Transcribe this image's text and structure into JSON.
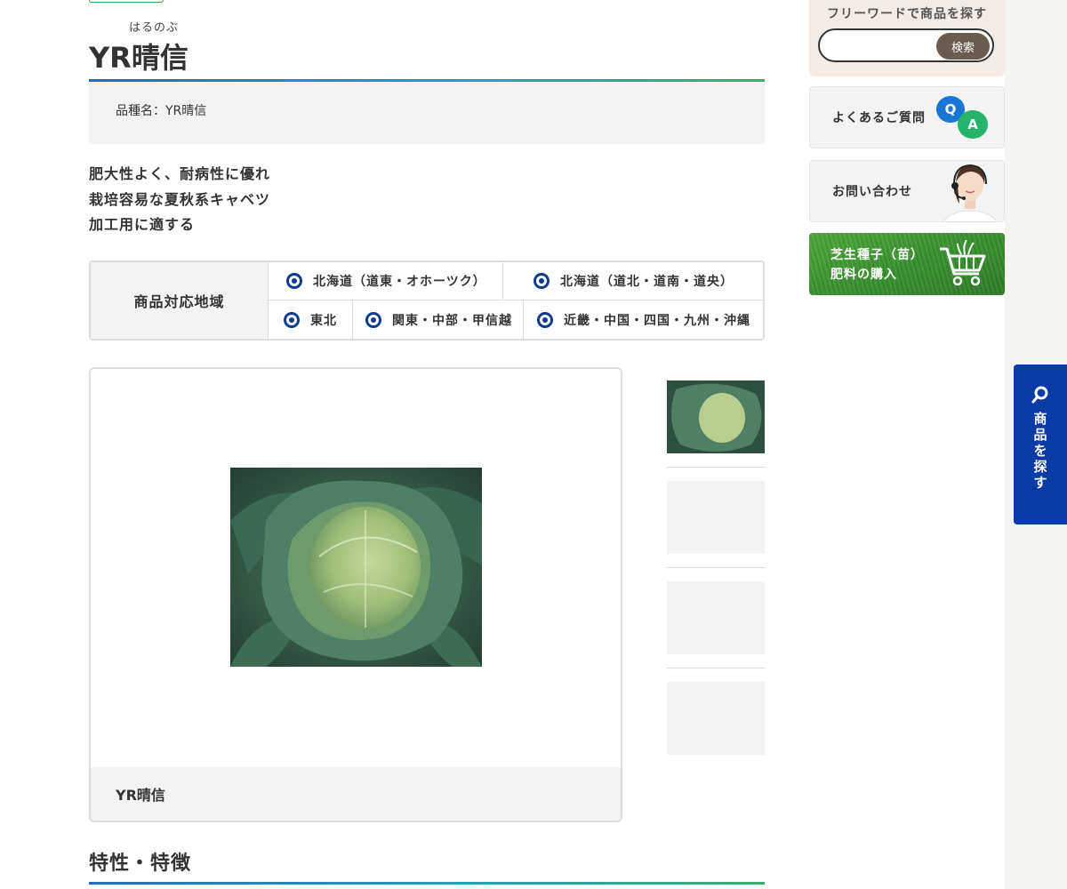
{
  "product": {
    "ruby": "はるのぶ",
    "title": "YR晴信",
    "variety_label": "品種名：YR晴信",
    "description": [
      "肥大性よく、耐病性に優れ",
      "栽培容易な夏秋系キャベツ",
      "加工用に適する"
    ]
  },
  "regions": {
    "heading": "商品対応地域",
    "items": [
      {
        "label": "北海道（道東・オホーツク）",
        "selected": true
      },
      {
        "label": "北海道（道北・道南・道央）",
        "selected": true
      },
      {
        "label": "東北",
        "selected": true
      },
      {
        "label": "関東・中部・甲信越",
        "selected": true
      },
      {
        "label": "近畿・中国・四国・九州・沖縄",
        "selected": true
      }
    ]
  },
  "gallery": {
    "caption": "YR晴信",
    "main_image": "cabbage-photo",
    "thumbnails": [
      "cabbage-thumb",
      "empty",
      "empty",
      "empty"
    ]
  },
  "section": {
    "title": "特性・特徴"
  },
  "sidebar": {
    "search_label": "フリーワードで商品を探す",
    "search_value": "",
    "search_placeholder": "",
    "search_button": "検索",
    "faq_label": "よくあるご質問",
    "faq_q": "Q",
    "faq_a": "A",
    "contact_label": "お問い合わせ",
    "buy_line1": "芝生種子（苗）",
    "buy_line2": "肥料の購入"
  },
  "float_tab": {
    "chars": [
      "商",
      "品",
      "を",
      "探",
      "す"
    ]
  },
  "colors": {
    "accent_blue": "#0a3aa6",
    "radio_blue": "#0d3c8c",
    "gradient_start": "#1c6fc4",
    "gradient_end": "#2fb56a",
    "search_button": "#6b5c50",
    "buy_green": "#3a9230"
  }
}
